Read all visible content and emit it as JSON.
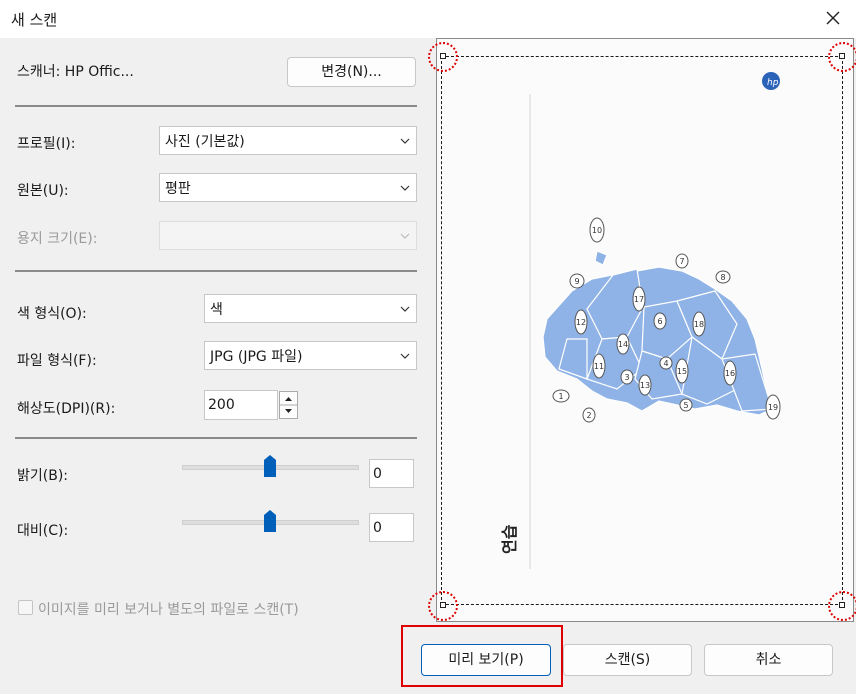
{
  "window": {
    "title": "새 스캔"
  },
  "scanner": {
    "label": "스캐너: HP Offic...",
    "change_button": "변경(N)..."
  },
  "profile": {
    "label": "프로필(I):",
    "value": "사진 (기본값)"
  },
  "source": {
    "label": "원본(U):",
    "value": "평판"
  },
  "paper_size": {
    "label": "용지 크기(E):",
    "value": ""
  },
  "color_format": {
    "label": "색 형식(O):",
    "value": "색"
  },
  "file_type": {
    "label": "파일 형식(F):",
    "value": "JPG (JPG 파일)"
  },
  "resolution": {
    "label": "해상도(DPI)(R):",
    "value": "200"
  },
  "brightness": {
    "label": "밝기(B):",
    "value": "0",
    "level": 0
  },
  "contrast": {
    "label": "대비(C):",
    "value": "0",
    "level": 0
  },
  "preview_option": {
    "label": "이미지를 미리 보거나 별도의 파일로 스캔(T)",
    "checked": false
  },
  "buttons": {
    "preview": "미리 보기(P)",
    "scan": "스캔(S)",
    "cancel": "취소"
  },
  "preview_image": {
    "map_numbers": [
      "1",
      "2",
      "3",
      "4",
      "5",
      "6",
      "7",
      "8",
      "9",
      "10",
      "11",
      "12",
      "13",
      "14",
      "15",
      "16",
      "17",
      "18",
      "19"
    ],
    "vertical_text": "연습"
  },
  "colors": {
    "map_fill": "#8fb3e6",
    "highlight": "#e00000",
    "accent": "#005fb8"
  }
}
